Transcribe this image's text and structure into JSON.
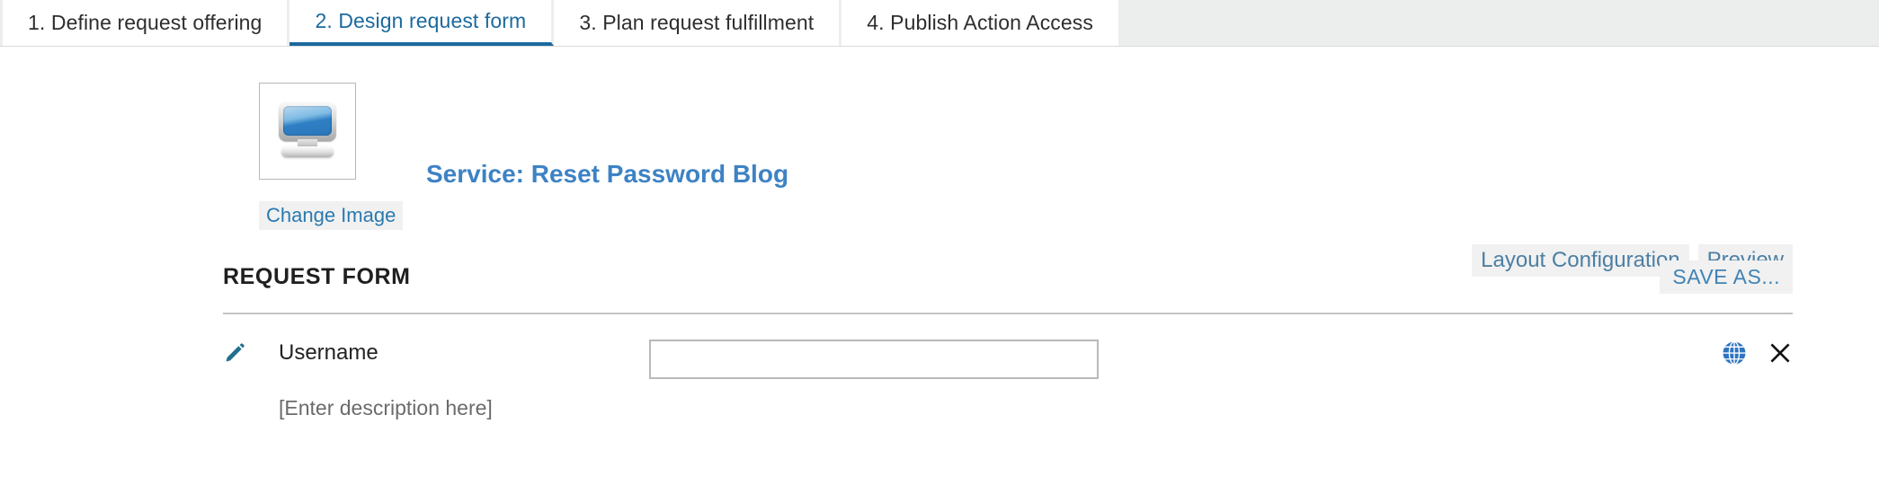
{
  "tabs": [
    {
      "label": "1. Define request offering",
      "active": false
    },
    {
      "label": "2. Design request form",
      "active": true
    },
    {
      "label": "3. Plan request fulfillment",
      "active": false
    },
    {
      "label": "4. Publish Action Access",
      "active": false
    }
  ],
  "header": {
    "thumbnail_icon": "monitor-icon",
    "change_image_label": "Change Image",
    "service_title": "Service: Reset Password Blog",
    "links": [
      {
        "label": "Layout Configuration",
        "name": "layout-configuration-link"
      },
      {
        "label": "Preview",
        "name": "preview-link"
      }
    ]
  },
  "form": {
    "section_title": "REQUEST FORM",
    "save_as_label": "SAVE AS...",
    "rows": [
      {
        "edit_icon": "pencil-icon",
        "label": "Username",
        "description": "[Enter description here]",
        "input_value": "",
        "input_placeholder": "",
        "globe_icon": "globe-icon",
        "remove_icon": "close-icon"
      }
    ]
  },
  "colors": {
    "accent_blue": "#1c6a9e",
    "title_blue": "#3d82c4",
    "link_blue": "#3f83b4",
    "tabbar_bg": "#eceded",
    "divider": "#c4c4c4",
    "pencil_teal": "#216f8e",
    "globe_blue": "#2f74c0"
  }
}
